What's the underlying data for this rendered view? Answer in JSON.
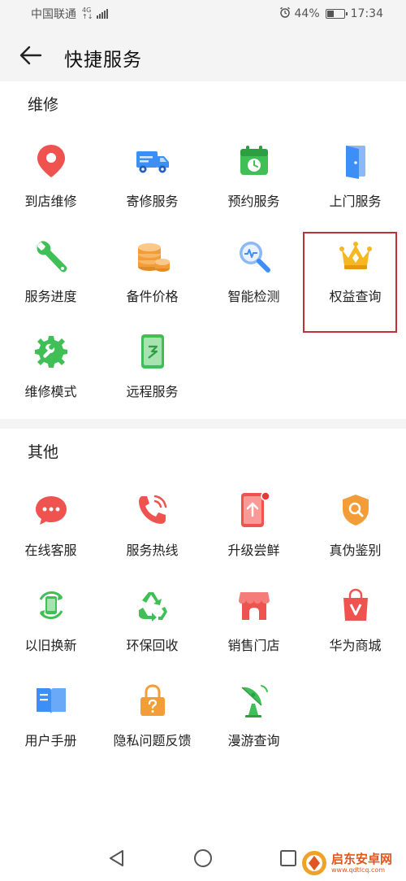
{
  "status": {
    "carrier": "中国联通",
    "net_top": "4G",
    "net_bottom": "↑↓",
    "battery": "44%",
    "battery_level": 0.44,
    "time": "17:34"
  },
  "header": {
    "title": "快捷服务"
  },
  "sections": {
    "repair": {
      "title": "维修",
      "items": [
        {
          "label": "到店维修",
          "icon": "location-pin-icon"
        },
        {
          "label": "寄修服务",
          "icon": "truck-icon"
        },
        {
          "label": "预约服务",
          "icon": "calendar-clock-icon"
        },
        {
          "label": "上门服务",
          "icon": "door-icon"
        },
        {
          "label": "服务进度",
          "icon": "wrench-icon"
        },
        {
          "label": "备件价格",
          "icon": "coins-icon"
        },
        {
          "label": "智能检测",
          "icon": "magnifier-icon"
        },
        {
          "label": "权益查询",
          "icon": "crown-icon"
        },
        {
          "label": "维修模式",
          "icon": "gear-wrench-icon"
        },
        {
          "label": "远程服务",
          "icon": "phone-remote-icon"
        }
      ]
    },
    "other": {
      "title": "其他",
      "items": [
        {
          "label": "在线客服",
          "icon": "chat-bubble-icon"
        },
        {
          "label": "服务热线",
          "icon": "phone-call-icon"
        },
        {
          "label": "升级尝鲜",
          "icon": "upgrade-phone-icon"
        },
        {
          "label": "真伪鉴别",
          "icon": "shield-search-icon"
        },
        {
          "label": "以旧换新",
          "icon": "recycle-phone-icon"
        },
        {
          "label": "环保回收",
          "icon": "recycle-icon"
        },
        {
          "label": "销售门店",
          "icon": "store-icon"
        },
        {
          "label": "华为商城",
          "icon": "shopping-bag-icon"
        },
        {
          "label": "用户手册",
          "icon": "book-icon"
        },
        {
          "label": "隐私问题反馈",
          "icon": "lock-question-icon"
        },
        {
          "label": "漫游查询",
          "icon": "satellite-dish-icon"
        }
      ]
    }
  },
  "watermark": {
    "main": "启东安卓网",
    "sub": "www.qdtlcq.com"
  },
  "colors": {
    "red": "#ef5350",
    "blue": "#3d8ef5",
    "green": "#3fbf55",
    "orange": "#f29d38",
    "highlight": "#c0303a"
  }
}
